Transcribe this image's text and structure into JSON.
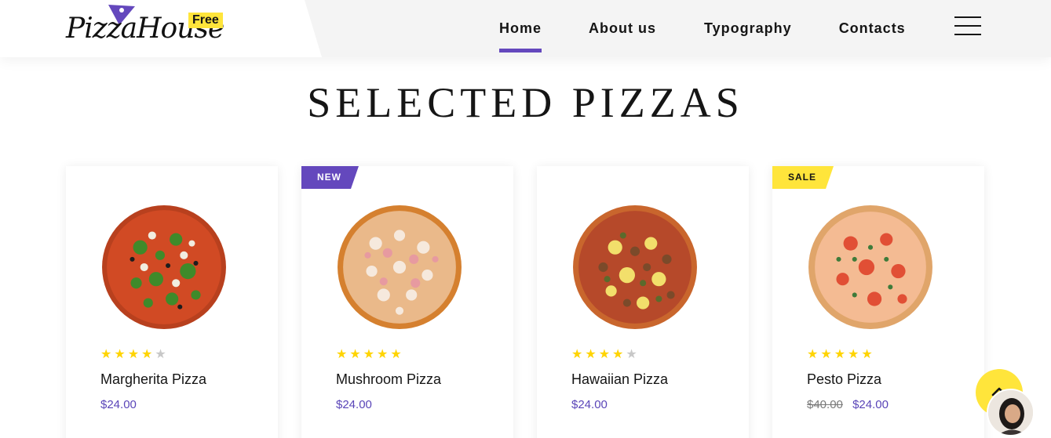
{
  "header": {
    "logo_text": "PizzaHouse",
    "logo_badge": "Free",
    "nav": [
      {
        "label": "Home",
        "active": true
      },
      {
        "label": "About us",
        "active": false
      },
      {
        "label": "Typography",
        "active": false
      },
      {
        "label": "Contacts",
        "active": false
      }
    ]
  },
  "section": {
    "title": "SELECTED PIZZAS"
  },
  "products": [
    {
      "name": "Margherita Pizza",
      "price": "$24.00",
      "old_price": "",
      "rating": 4,
      "badge": ""
    },
    {
      "name": "Mushroom Pizza",
      "price": "$24.00",
      "old_price": "",
      "rating": 5,
      "badge": "NEW"
    },
    {
      "name": "Hawaiian Pizza",
      "price": "$24.00",
      "old_price": "",
      "rating": 4,
      "badge": ""
    },
    {
      "name": "Pesto Pizza",
      "price": "$24.00",
      "old_price": "$40.00",
      "rating": 5,
      "badge": "SALE"
    }
  ],
  "icons": {
    "menu": "hamburger-menu-icon",
    "scroll_top": "chevron-up-icon",
    "chat": "chat-avatar"
  },
  "colors": {
    "accent": "#6448bd",
    "yellow": "#ffe53b",
    "star": "#ffd400",
    "price": "#5a45b8"
  }
}
